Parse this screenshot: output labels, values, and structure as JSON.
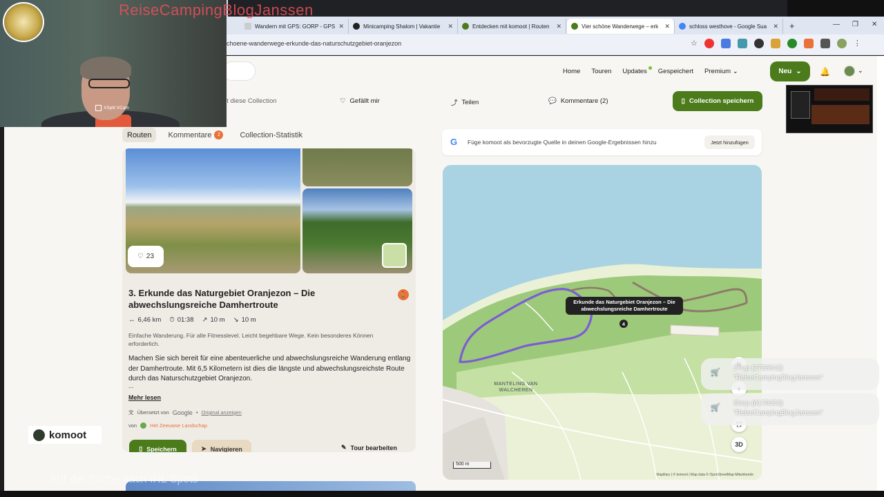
{
  "browser": {
    "tabs": [
      {
        "label": "Wandern mit GPS: GORP - GPS"
      },
      {
        "label": "Minicamping Shalom | Vakantie"
      },
      {
        "label": "Entdecken mit komoot | Routen"
      },
      {
        "label": "Vier schöne Wanderwege – erk"
      },
      {
        "label": "schloss westhove - Google Sua"
      }
    ],
    "url": "choene-wanderwege-erkunde-das-naturschutzgebiet-oranjezon"
  },
  "nav": {
    "links": [
      "Home",
      "Touren",
      "Updates",
      "Gespeichert",
      "Premium"
    ],
    "new_label": "Neu"
  },
  "actions": {
    "liked_by_text": "llt diese Collection",
    "like_label": "Gefällt mir",
    "share_label": "Teilen",
    "comments_label": "Kommentare (2)",
    "save_collection_label": "Collection speichern"
  },
  "subtabs": {
    "routes": "Routen",
    "comments": "Kommentare",
    "comments_count": "2",
    "stats": "Collection-Statistik"
  },
  "card": {
    "likes": "23",
    "title": "3. Erkunde das Naturgebiet Oranjezon – Die abwechslungsreiche Damhertroute",
    "distance": "6,46 km",
    "duration": "01:38",
    "ascent": "10 m",
    "descent": "10 m",
    "difficulty": "Einfache Wanderung. Für alle Fitnesslevel. Leicht begehbare Wege. Kein besonderes Können erforderlich.",
    "description": "Machen Sie sich bereit für eine abenteuerliche und abwechslungsreiche Wanderung entlang der Damhertroute. Mit 6,5 Kilometern ist dies die längste und abwechslungsreichste Route durch das Naturschutzgebiet Oranjezon.",
    "ellipsis": "...",
    "more_label": "Mehr lesen",
    "translated_by": "Übersetzt von",
    "translator": "Google",
    "original_label": "Original anzeigen",
    "by_label": "von",
    "organization": "Het Zeeuwse Landschap",
    "save_label": "Speichern",
    "navigate_label": "Navigieren",
    "edit_label": "Tour bearbeiten"
  },
  "google_banner": {
    "text": "Füge komoot als bevorzugte Quelle in deinen Google-Ergebnissen hinzu",
    "button": "Jetzt hinzufügen"
  },
  "map": {
    "tooltip": "Erkunde das Naturgebiet Oranjezon – Die abwechslungsreiche Damhertroute",
    "marker_number": "4",
    "place_label": "MANTELING VAN WALCHEREN",
    "scale": "500 m",
    "attribution": "Mapillary | © komoot | Map data © OpenStreetMap-Mitwirkende",
    "compass": "N",
    "zoom_in": "+",
    "mode_3d": "3D"
  },
  "toasts": [
    {
      "line1": "Shop (2756642)",
      "line2": "\"ReiseCampingBlogJanssen\""
    },
    {
      "line1": "Shop (6178053)",
      "line2": "\"ReiseCampingBlogJanssen\""
    }
  ],
  "overlay": {
    "brand": "ReiseCampingBlogJanssen",
    "webcam_label": "XSplit VCam",
    "komoot_logo": "komoot",
    "caption": "Auf der Suche nach IRL Spots"
  },
  "colors": {
    "brand_green": "#4b7b1b",
    "accent_orange": "#e8723a",
    "route_purple": "#7b5cd6"
  }
}
